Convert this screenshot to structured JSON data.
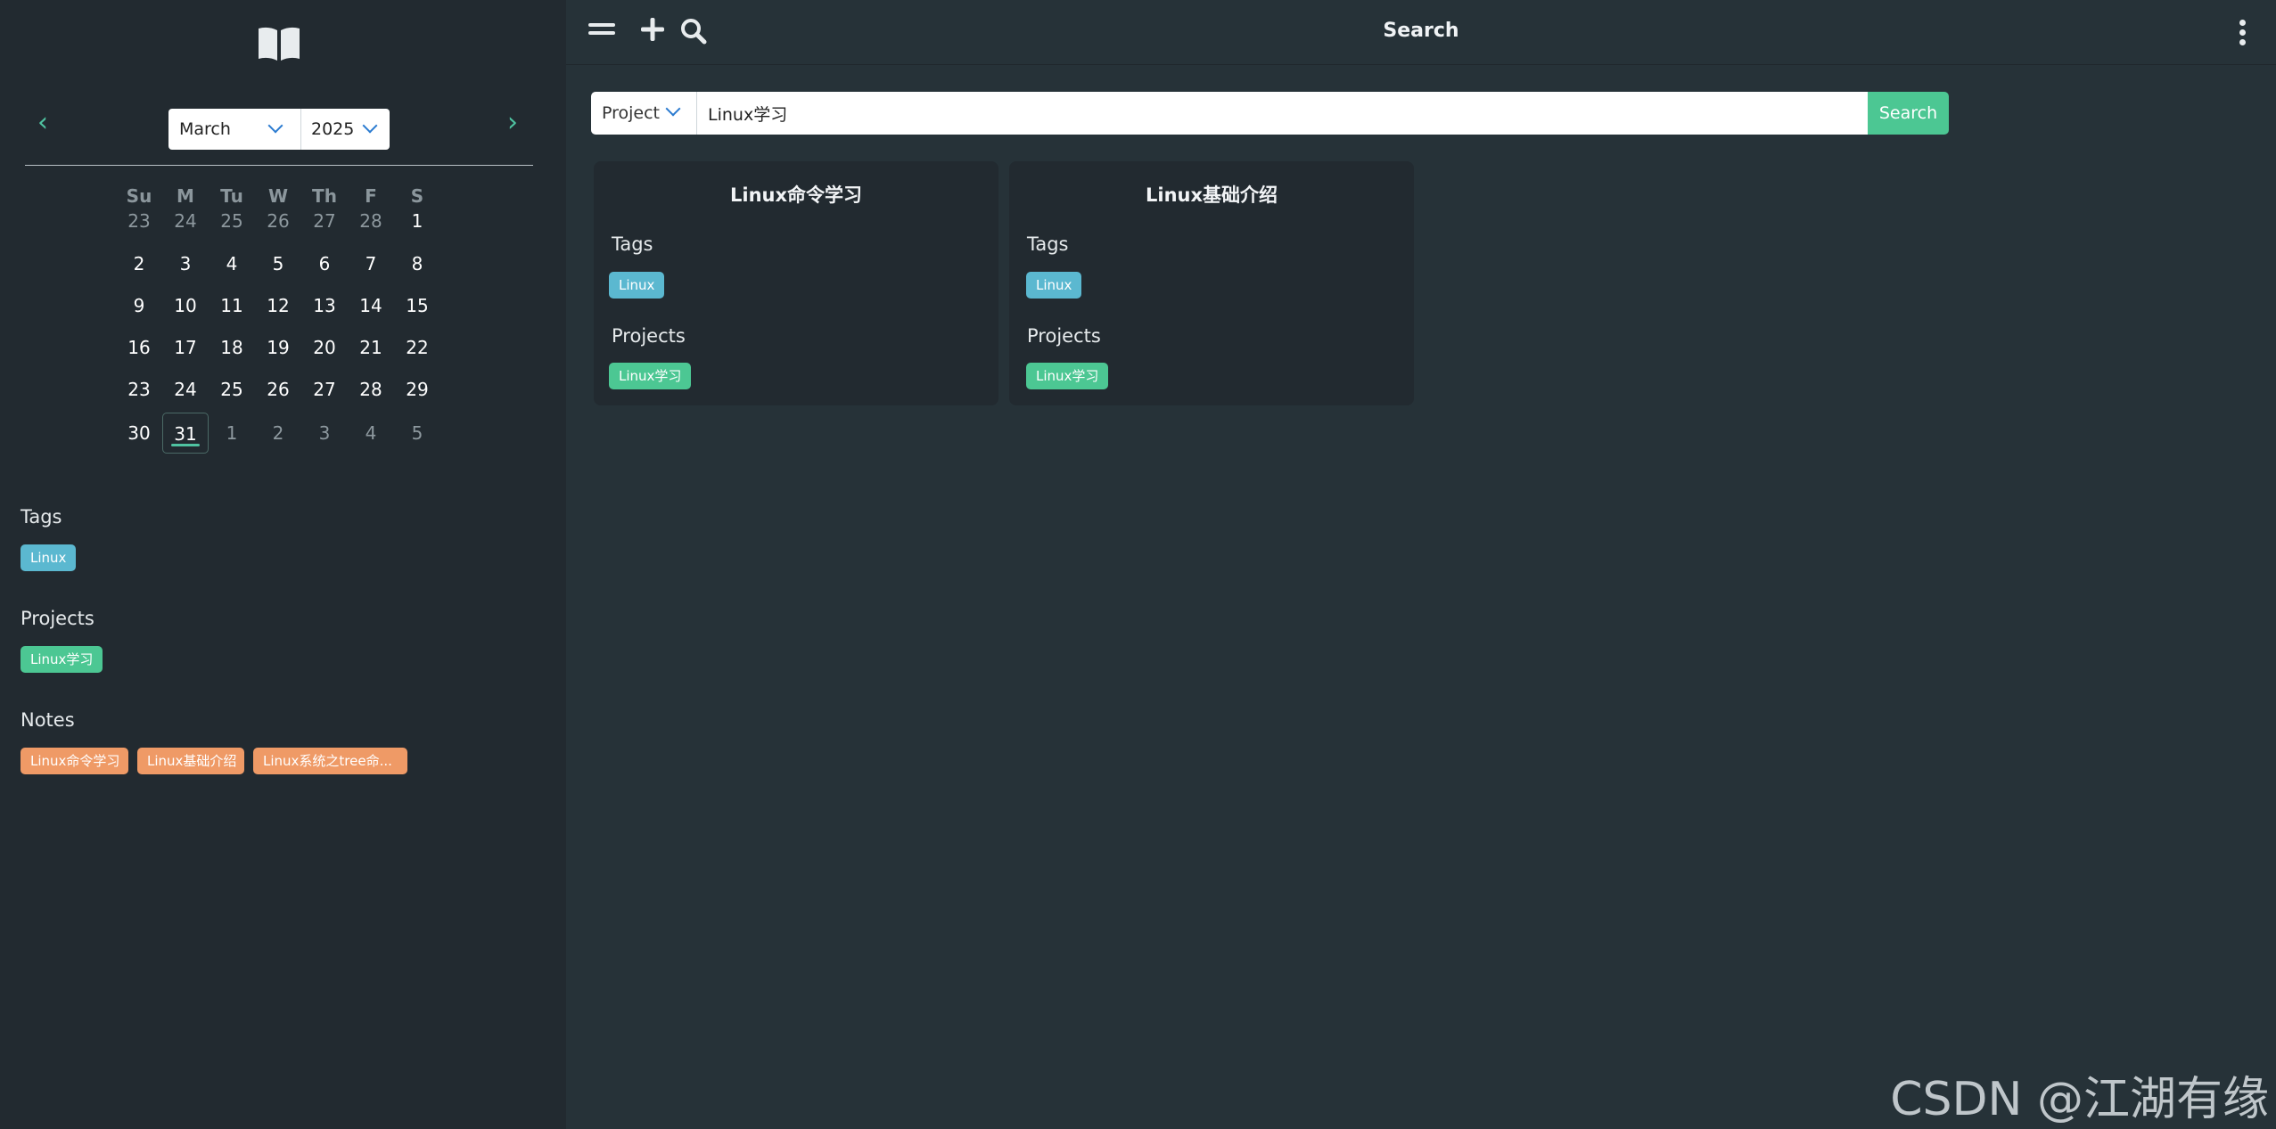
{
  "header": {
    "title": "Search"
  },
  "calendar": {
    "month": "March",
    "year": "2025",
    "weekdays": [
      "Su",
      "M",
      "Tu",
      "W",
      "Th",
      "F",
      "S"
    ],
    "days": [
      [
        "23",
        "24",
        "25",
        "26",
        "27",
        "28",
        "1"
      ],
      [
        "2",
        "3",
        "4",
        "5",
        "6",
        "7",
        "8"
      ],
      [
        "9",
        "10",
        "11",
        "12",
        "13",
        "14",
        "15"
      ],
      [
        "16",
        "17",
        "18",
        "19",
        "20",
        "21",
        "22"
      ],
      [
        "23",
        "24",
        "25",
        "26",
        "27",
        "28",
        "29"
      ],
      [
        "30",
        "31",
        "1",
        "2",
        "3",
        "4",
        "5"
      ]
    ]
  },
  "sidebar": {
    "tags_title": "Tags",
    "tags": [
      "Linux"
    ],
    "projects_title": "Projects",
    "projects": [
      "Linux学习"
    ],
    "notes_title": "Notes",
    "notes": [
      "Linux命令学习",
      "Linux基础介绍",
      "Linux系统之tree命..."
    ]
  },
  "search": {
    "filter": "Project",
    "query": "Linux学习",
    "button": "Search"
  },
  "results": [
    {
      "title": "Linux命令学习",
      "tags_label": "Tags",
      "tag": "Linux",
      "projects_label": "Projects",
      "project": "Linux学习"
    },
    {
      "title": "Linux基础介绍",
      "tags_label": "Tags",
      "tag": "Linux",
      "projects_label": "Projects",
      "project": "Linux学习"
    }
  ],
  "colors": {
    "background": "#263238",
    "sidebar": "#222a30",
    "accent": "#4fc3a1",
    "tag": "#5bb8d0",
    "project": "#4cc793",
    "note": "#ef9a66"
  },
  "watermark": "CSDN @江湖有缘"
}
